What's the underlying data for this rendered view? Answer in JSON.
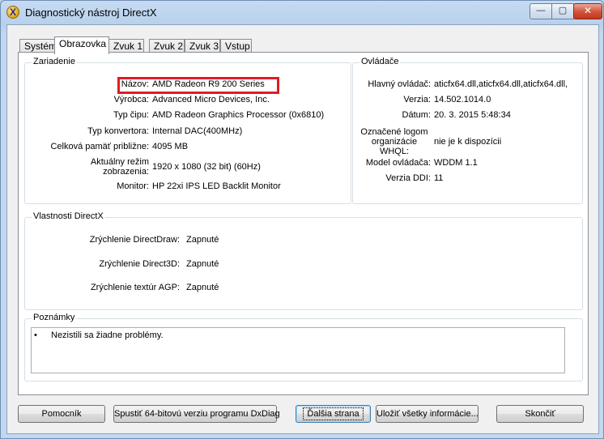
{
  "window": {
    "title": "Diagnostický nástroj DirectX",
    "controls": {
      "minimize": "—",
      "maximize": "▢",
      "close": "✕"
    }
  },
  "tabs": [
    {
      "label": "Systém",
      "active": false
    },
    {
      "label": "Obrazovka",
      "active": true
    },
    {
      "label": "Zvuk 1",
      "active": false
    },
    {
      "label": "Zvuk 2",
      "active": false
    },
    {
      "label": "Zvuk 3",
      "active": false
    },
    {
      "label": "Vstup",
      "active": false
    }
  ],
  "device": {
    "legend": "Zariadenie",
    "rows": [
      {
        "label": "Názov:",
        "value": "AMD Radeon R9 200 Series"
      },
      {
        "label": "Výrobca:",
        "value": "Advanced Micro Devices, Inc."
      },
      {
        "label": "Typ čipu:",
        "value": "AMD Radeon Graphics Processor (0x6810)"
      },
      {
        "label": "Typ konvertora:",
        "value": "Internal DAC(400MHz)"
      },
      {
        "label": "Celková pamäť približne:",
        "value": "4095 MB"
      },
      {
        "label": "Aktuálny režim zobrazenia:",
        "value": "1920 x 1080 (32 bit) (60Hz)"
      },
      {
        "label": "Monitor:",
        "value": "HP 22xi IPS LED Backlit Monitor"
      }
    ]
  },
  "drivers": {
    "legend": "Ovládače",
    "rows": [
      {
        "label": "Hlavný ovládač:",
        "value": "aticfx64.dll,aticfx64.dll,aticfx64.dll,"
      },
      {
        "label": "Verzia:",
        "value": "14.502.1014.0"
      },
      {
        "label": "Dátum:",
        "value": "20. 3. 2015 5:48:34"
      },
      {
        "label": "Označené logom organizácie WHQL:",
        "value": "nie je k dispozícii"
      },
      {
        "label": "Model ovládača:",
        "value": "WDDM 1.1"
      },
      {
        "label": "Verzia DDI:",
        "value": "11"
      }
    ]
  },
  "directx": {
    "legend": "Vlastnosti DirectX",
    "rows": [
      {
        "label": "Zrýchlenie DirectDraw:",
        "value": "Zapnuté"
      },
      {
        "label": "Zrýchlenie Direct3D:",
        "value": "Zapnuté"
      },
      {
        "label": "Zrýchlenie textúr AGP:",
        "value": "Zapnuté"
      }
    ]
  },
  "notes": {
    "legend": "Poznámky",
    "bullet": "•",
    "items": [
      "Nezistili sa žiadne problémy."
    ]
  },
  "buttons": {
    "help": "Pomocník",
    "run64": "Spustiť 64-bitovú verziu programu DxDiag",
    "next": "Ďalšia strana",
    "save": "Uložiť všetky informácie...",
    "exit": "Skončiť"
  }
}
